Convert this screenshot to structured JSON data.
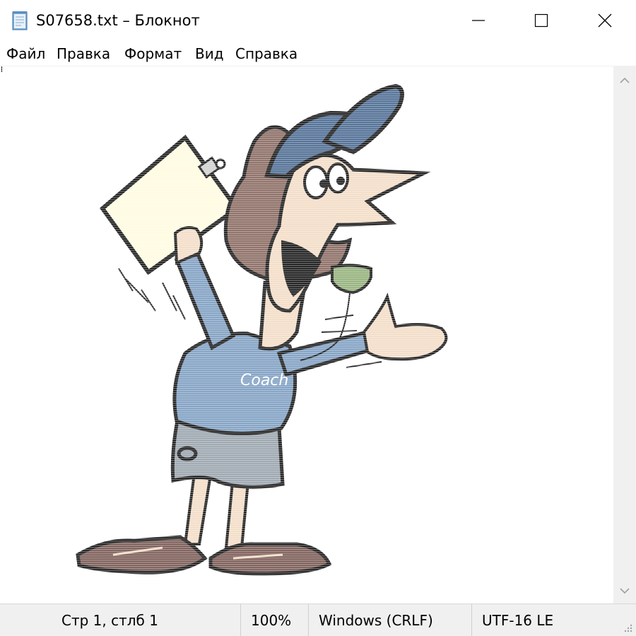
{
  "window": {
    "title": "S07658.txt – Блокнот"
  },
  "menu": {
    "items": [
      {
        "label": "Файл"
      },
      {
        "label": "Правка"
      },
      {
        "label": "Формат"
      },
      {
        "label": "Вид"
      },
      {
        "label": "Справка"
      }
    ]
  },
  "editor": {
    "content_description_icon": "cartoon-coach-ascii-art",
    "shirt_text": "Coach"
  },
  "statusbar": {
    "position": "Стр 1, стлб 1",
    "zoom": "100%",
    "line_endings": "Windows (CRLF)",
    "encoding": "UTF-16 LE"
  },
  "colors": {
    "shirt": "#7f9fc2",
    "cap": "#4d6c92",
    "hair": "#8a6b62",
    "skin": "#f3dcc6",
    "clipboard_paper": "#fffbe0",
    "whistle": "#93b07a",
    "shoes": "#7a5a55",
    "outline": "#1a1a1a"
  }
}
